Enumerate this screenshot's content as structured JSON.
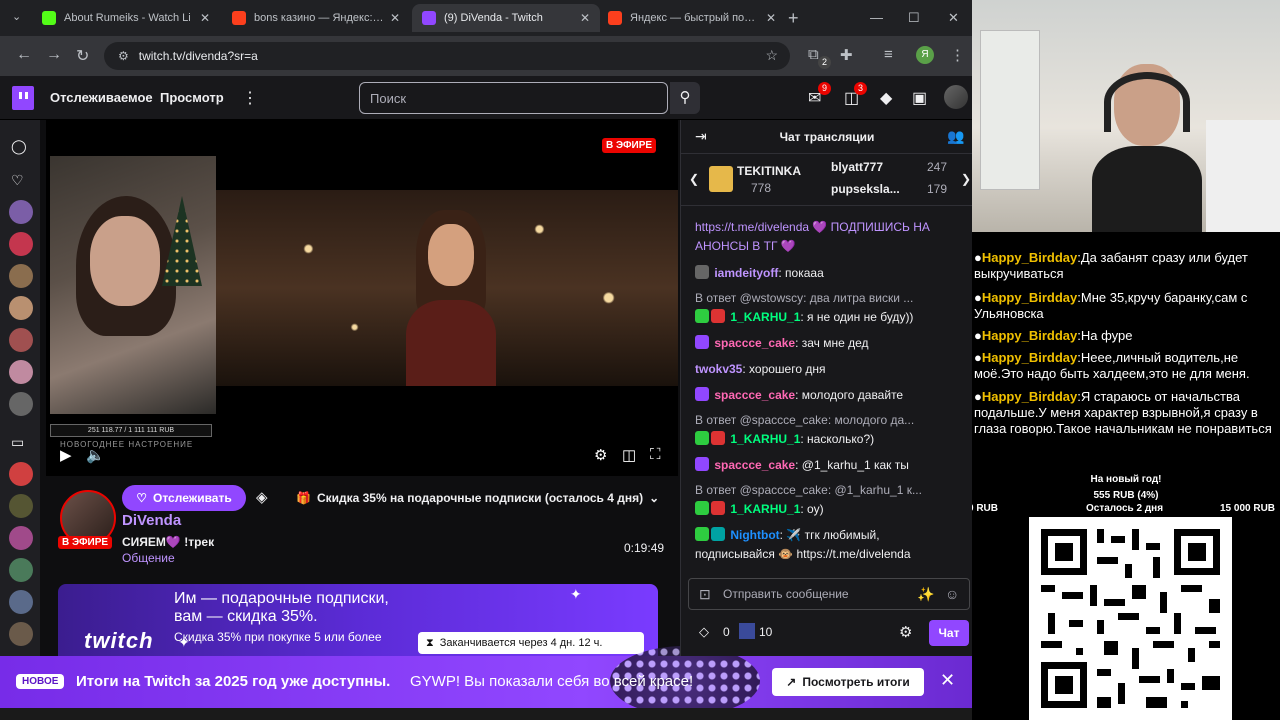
{
  "browser": {
    "tabs": [
      {
        "label": "About Rumeiks - Watch Li",
        "color": "#53fc18"
      },
      {
        "label": "bons казино — Яндекс: на",
        "color": "#fc3f1d"
      },
      {
        "label": "(9) DiVenda - Twitch",
        "color": "#9147ff"
      },
      {
        "label": "Яндекс — быстрый поиск",
        "color": "#fc3f1d"
      }
    ],
    "url": "twitch.tv/divenda?sr=a",
    "profile_letter": "Я",
    "ext_badge": "2"
  },
  "header": {
    "nav": [
      "Отслеживаемое",
      "Просмотр"
    ],
    "search_placeholder": "Поиск",
    "inbox_count": "9",
    "notif_count": "3"
  },
  "player": {
    "live_label": "В ЭФИРЕ",
    "goal_text": "251 118.77 / 1 111 111 RUB",
    "overlay_caption": "НОВОГОДНЕЕ НАСТРОЕНИЕ"
  },
  "channel": {
    "follow_label": "Отслеживать",
    "promo": "Скидка 35% на подарочные подписки (осталось 4 дня)",
    "name": "DiVenda",
    "live_label": "В ЭФИРЕ",
    "title": "СИЯЕМ💜 !трек",
    "category": "Общение",
    "uptime": "0:19:49"
  },
  "sub_banner": {
    "logo_text": "twitch",
    "line1": "Им — подарочные подписки,",
    "line2": "вам — скидка 35%.",
    "line3": "Скидка 35% при покупке 5 или более",
    "timer": "Заканчивается через 4 дн. 12 ч."
  },
  "notification": {
    "badge": "НОВОЕ",
    "text": "Итоги на Twitch за 2025 год уже доступны.",
    "sub": "GYWP! Вы показали себя во всей красе!",
    "button": "Посмотреть итоги"
  },
  "chat": {
    "title": "Чат трансляции",
    "leaders": [
      {
        "name": "TEKITINKA",
        "value": "778"
      },
      {
        "name": "blyatt777",
        "value": "247"
      },
      {
        "name": "pupseksla...",
        "value": "179"
      }
    ],
    "messages": [
      {
        "type": "text",
        "user": "",
        "color": "#bf94ff",
        "text": "https://t.me/divelenda 💜 ПОДПИШИСЬ НА АНОНСЫ В ТГ 💜"
      },
      {
        "type": "msg",
        "user": "iamdeityoff",
        "color": "#bf94ff",
        "text": "покааа"
      },
      {
        "type": "reply",
        "text": "В ответ @wstowscy: два литра виски ..."
      },
      {
        "type": "msg",
        "user": "1_KARHU_1",
        "color": "#00ff7f",
        "text": "я не один не буду))"
      },
      {
        "type": "msg",
        "user": "spaccce_cake",
        "color": "#ff69b4",
        "text": "зач мне дед"
      },
      {
        "type": "msg",
        "user": "twokv35",
        "color": "#bf94ff",
        "text": "хорошего дня"
      },
      {
        "type": "msg",
        "user": "spaccce_cake",
        "color": "#ff69b4",
        "text": "молодого давайте"
      },
      {
        "type": "reply",
        "text": "В ответ @spaccce_cake: молодого да..."
      },
      {
        "type": "msg",
        "user": "1_KARHU_1",
        "color": "#00ff7f",
        "text": "насколько?)"
      },
      {
        "type": "msg",
        "user": "spaccce_cake",
        "color": "#ff69b4",
        "text": "@1_karhu_1 как ты"
      },
      {
        "type": "reply",
        "text": "В ответ @spaccce_cake: @1_karhu_1 к..."
      },
      {
        "type": "msg",
        "user": "1_KARHU_1",
        "color": "#00ff7f",
        "text": "оу)"
      },
      {
        "type": "msg",
        "user": "Nightbot",
        "color": "#1e90ff",
        "text": "✈️ тгк любимый, подписывайся 🐵 https://t.me/divelenda"
      }
    ],
    "input_placeholder": "Отправить сообщение",
    "points": "0",
    "bits": "10",
    "send_label": "Чат"
  },
  "overlay": {
    "messages": [
      {
        "user": "Happy_Birdday",
        "text": "Да забанят сразу или будет выкручиваться"
      },
      {
        "user": "Happy_Birdday",
        "text": "Мне 35,кручу баранку,сам с Ульяновска"
      },
      {
        "user": "Happy_Birdday",
        "text": "На фуре"
      },
      {
        "user": "Happy_Birdday",
        "text": "Неее,личный водитель,не моё.Это надо быть халдеем,это не для меня."
      },
      {
        "user": "Happy_Birdday",
        "text": "Я стараюсь от начальства подальше.У меня характер взрывной,я сразу в глаза говорю.Такое начальникам не понравиться"
      }
    ],
    "goal_title": "На новый год!",
    "goal_amount": "555 RUB (4%)",
    "goal_min": "0 RUB",
    "goal_remaining": "Осталось 2 дня",
    "goal_max": "15 000 RUB"
  }
}
